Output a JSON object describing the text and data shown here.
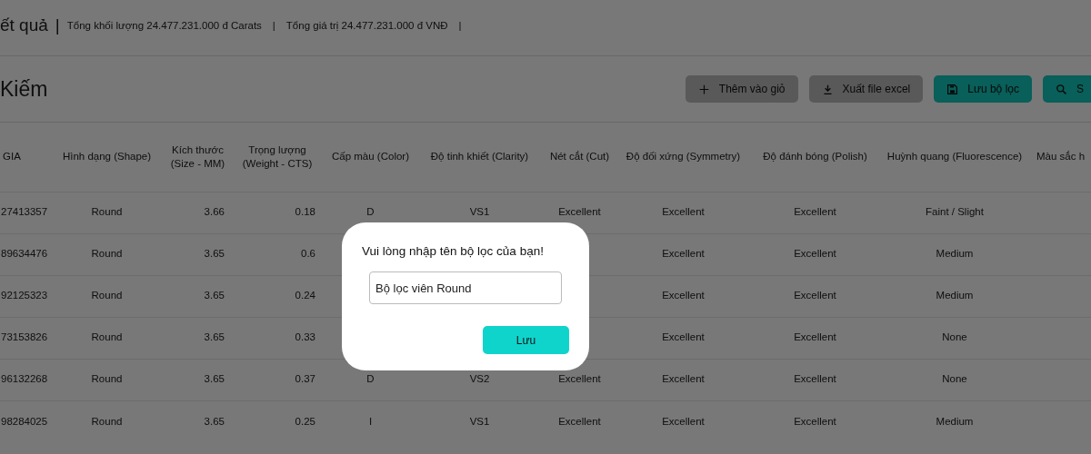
{
  "summary": {
    "title": "ết quả",
    "separator": "|",
    "stats": [
      {
        "text": "Tổng khối lượng 24.477.231.000 đ Carats",
        "separator": "|"
      },
      {
        "text": "Tổng giá trị 24.477.231.000 đ VNĐ",
        "separator": "|"
      }
    ]
  },
  "search_header": {
    "title": "Kiếm"
  },
  "actions": [
    {
      "label": "Thêm vào giỏ",
      "kind": "plus",
      "primary": false
    },
    {
      "label": "Xuất file excel",
      "kind": "download",
      "primary": false
    },
    {
      "label": "Lưu bộ lọc",
      "kind": "save",
      "primary": true
    },
    {
      "label": "S",
      "kind": "search",
      "primary": true
    }
  ],
  "table": {
    "columns": [
      "GIA",
      "Hình dạng (Shape)",
      "Kích thước (Size - MM)",
      "Trọng lượng (Weight - CTS)",
      "Cấp màu (Color)",
      "Độ tinh khiết (Clarity)",
      "Nét cắt (Cut)",
      "Độ đối xứng (Symmetry)",
      "Độ đánh bóng (Polish)",
      "Huỳnh quang (Fluorescence)",
      "Màu sắc h"
    ],
    "rows": [
      [
        "27413357",
        "Round",
        "3.66",
        "0.18",
        "D",
        "VS1",
        "Excellent",
        "Excellent",
        "Excellent",
        "Faint / Slight"
      ],
      [
        "89634476",
        "Round",
        "3.65",
        "0.6",
        null,
        null,
        null,
        "Excellent",
        "Excellent",
        "Medium"
      ],
      [
        "92125323",
        "Round",
        "3.65",
        "0.24",
        null,
        null,
        null,
        "Excellent",
        "Excellent",
        "Medium"
      ],
      [
        "73153826",
        "Round",
        "3.65",
        "0.33",
        null,
        null,
        null,
        "Excellent",
        "Excellent",
        "None"
      ],
      [
        "96132268",
        "Round",
        "3.65",
        "0.37",
        "D",
        "VS2",
        "Excellent",
        "Excellent",
        "Excellent",
        "None"
      ],
      [
        "98284025",
        "Round",
        "3.65",
        "0.25",
        "I",
        "VS1",
        "Excellent",
        "Excellent",
        "Excellent",
        "Medium"
      ]
    ]
  },
  "dialog": {
    "title": "Vui lòng nhập tên bộ lọc của bạn!",
    "input_value": "Bộ lọc viên Round",
    "button": "Lưu"
  }
}
